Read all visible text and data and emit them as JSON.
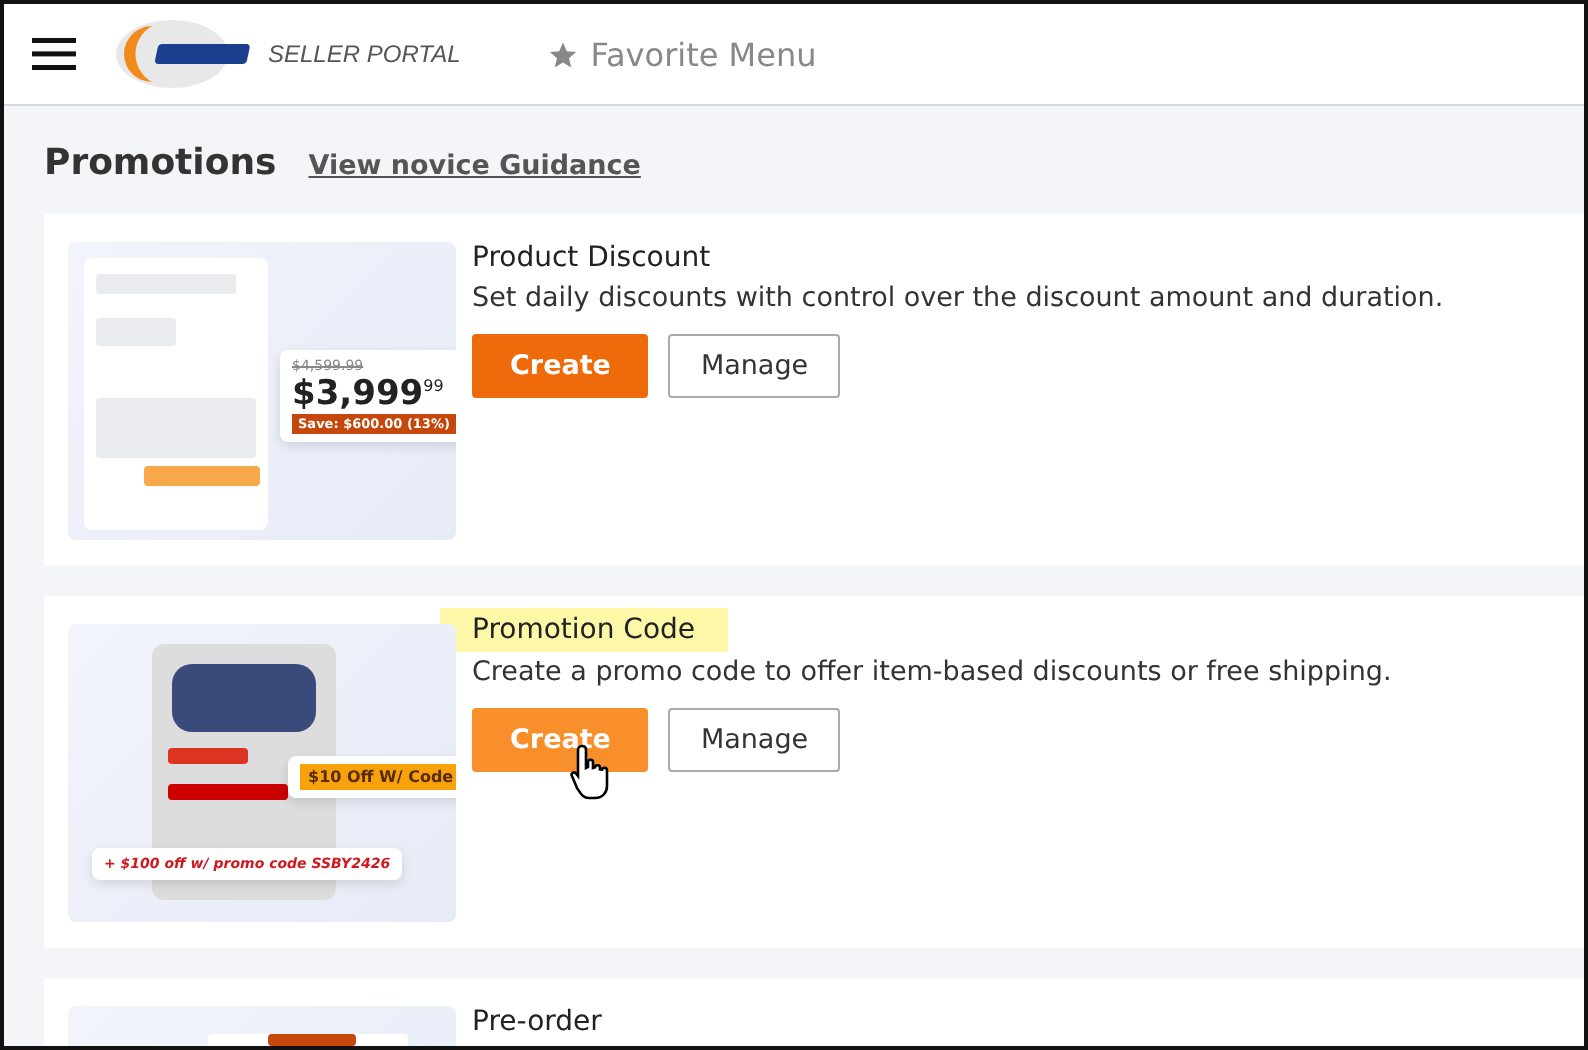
{
  "header": {
    "logo_text": "SELLER PORTAL",
    "favorite": "Favorite Menu"
  },
  "page": {
    "title": "Promotions",
    "guide_link": "View novice Guidance"
  },
  "promotions": [
    {
      "kind": "discount",
      "title": "Product Discount",
      "highlighted": false,
      "description": "Set daily discounts with control over the discount amount and duration.",
      "buttons": [
        {
          "label": "Create",
          "primary": true,
          "hovered": false
        },
        {
          "label": "Manage",
          "primary": false,
          "hovered": false
        }
      ],
      "callout": {
        "old_price": "$4,599.99",
        "price": "$3,999",
        "cents": "99",
        "save": "Save: $600.00 (13%)"
      }
    },
    {
      "kind": "code",
      "title": "Promotion Code",
      "highlighted": true,
      "description": "Create a promo code to offer item-based discounts or free shipping.",
      "buttons": [
        {
          "label": "Create",
          "primary": true,
          "hovered": true
        },
        {
          "label": "Manage",
          "primary": false,
          "hovered": false
        }
      ],
      "callout": {
        "tag": "$10 Off W/ Code",
        "promo": "+ $100 off w/ promo code SSBY2426"
      }
    },
    {
      "kind": "preorder",
      "title": "Pre-order",
      "highlighted": false
    }
  ]
}
